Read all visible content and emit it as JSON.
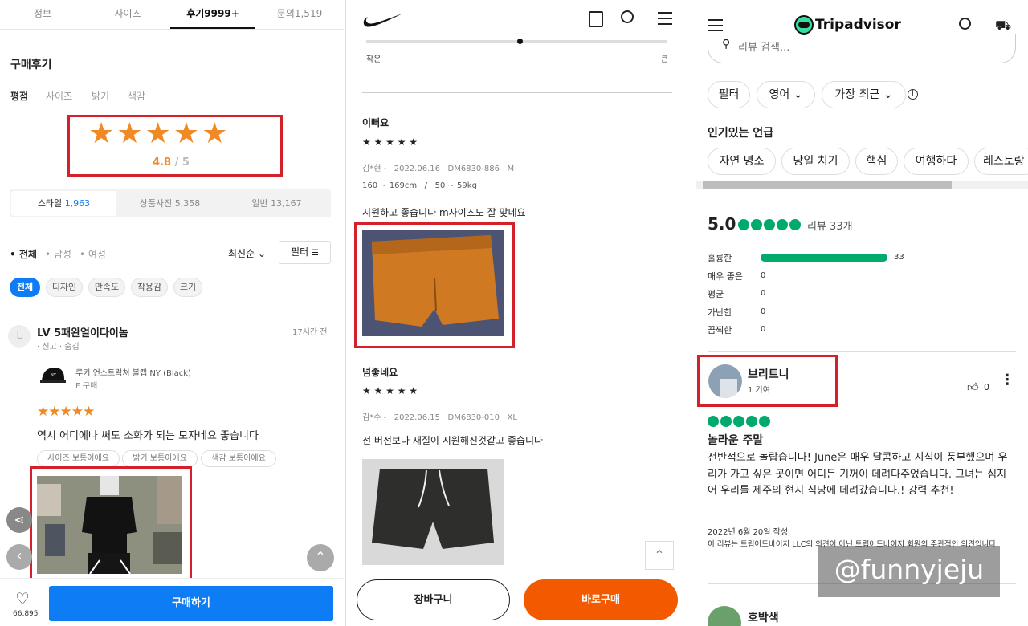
{
  "p1": {
    "tabs": [
      "정보",
      "사이즈",
      "후기9999+",
      "문의1,519"
    ],
    "title": "구매후기",
    "sub_tabs": [
      "평점",
      "사이즈",
      "밝기",
      "색감"
    ],
    "rating": "4.8",
    "rating_max": "/ 5",
    "seg": [
      {
        "label": "스타일",
        "count": "1,963"
      },
      {
        "label": "상품사진",
        "count": "5,358"
      },
      {
        "label": "일반",
        "count": "13,167"
      }
    ],
    "gender": [
      "• 전체",
      "• 남성",
      "• 여성"
    ],
    "sort": "최신순",
    "filter": "필터",
    "chips": [
      "전체",
      "디자인",
      "만족도",
      "착용감",
      "크기"
    ],
    "review": {
      "avatar": "L",
      "user": "LV 5패완얼이다이놈",
      "meta": "· 신고 · 숨김",
      "time": "17시간 전",
      "product": "루키 언스트럭쳐 볼캡 NY (Black)",
      "option": "F 구매",
      "stars": "★★★★★",
      "text": "역시 어디에나 써도 소화가 되는 모자네요 좋습니다",
      "opts": [
        "사이즈 보통이에요",
        "밝기 보통이에요",
        "색감 보통이에요"
      ]
    },
    "likes": "66,895",
    "buy": "구매하기"
  },
  "p2": {
    "slider_left": "작은",
    "slider_right": "큰",
    "r1": {
      "title": "이뻐요",
      "stars": "★ ★ ★ ★ ★",
      "meta": "김*현 -   2022.06.16   DM6830-886   M",
      "body": "160 ~ 169cm   /   50 ~ 59kg",
      "text": "시원하고 좋습니다 m사이즈도 잘 맞네요"
    },
    "r2": {
      "title": "넘좋네요",
      "stars": "★ ★ ★ ★ ★",
      "meta": "김*수 -   2022.06.15   DM6830-010   XL",
      "text": "전 버전보다 재질이 시원해진것같고 좋습니다"
    },
    "cart": "장바구니",
    "buy_now": "바로구매"
  },
  "p3": {
    "brand": "Tripadvisor",
    "search_placeholder": "리뷰 검색...",
    "filters": [
      "필터",
      "영어",
      "가장 최근"
    ],
    "popular_title": "인기있는 언급",
    "mentions": [
      "자연 명소",
      "당일 치기",
      "핵심",
      "여행하다",
      "레스토랑"
    ],
    "score": "5.0",
    "review_count": "리뷰 33개",
    "bars": [
      {
        "label": "훌륭한",
        "count": "33",
        "frac": 1
      },
      {
        "label": "매우 좋은",
        "count": "0",
        "frac": 0
      },
      {
        "label": "평균",
        "count": "0",
        "frac": 0
      },
      {
        "label": "가난한",
        "count": "0",
        "frac": 0
      },
      {
        "label": "끔찍한",
        "count": "0",
        "frac": 0
      }
    ],
    "reviewer": "브리트니",
    "contrib": "1 기여",
    "likes": "0",
    "review_title": "놀라운 주말",
    "review_body": "전반적으로 놀랍습니다! June은 매우 달콤하고 지식이 풍부했으며 우리가 가고 싶은 곳이면 어디든 기꺼이 데려다주었습니다. 그녀는 심지어 우리를 제주의 현지 식당에 데려갔습니다.! 강력 추천!",
    "date": "2022년 6월 20일 작성",
    "disclaimer": "이 리뷰는 트립어드바이저 LLC의 의견이 아닌 트립어드바이저 회원의 주관적인 의견입니다.",
    "next_reviewer": "호박색",
    "watermark": "@funnyjeju"
  },
  "colors": {
    "orange": "#f08a24",
    "blue": "#0e7cf4",
    "nike_orange": "#f35a00",
    "green": "#00aa6c",
    "red": "#d4202a"
  }
}
